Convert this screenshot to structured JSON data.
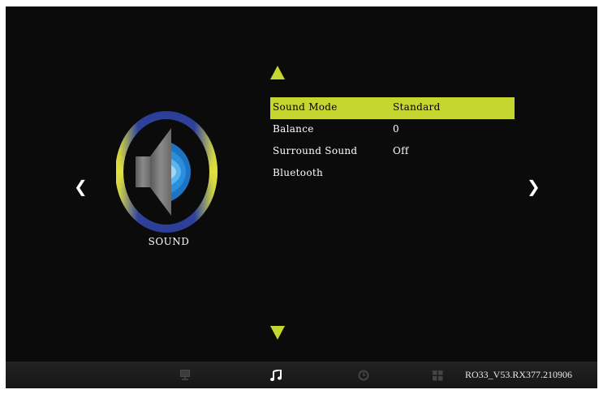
{
  "menu": {
    "items": [
      {
        "label": "Sound Mode",
        "value": "Standard",
        "selected": true
      },
      {
        "label": "Balance",
        "value": "0",
        "selected": false
      },
      {
        "label": "Surround Sound",
        "value": "Off",
        "selected": false
      },
      {
        "label": "Bluetooth",
        "value": "",
        "selected": false
      }
    ]
  },
  "section": {
    "label": "SOUND",
    "icon": "speaker-icon"
  },
  "nav": {
    "prev_glyph": "❮",
    "next_glyph": "❯",
    "tabs": [
      {
        "icon": "picture-icon",
        "active": false
      },
      {
        "icon": "music-note-icon",
        "active": true
      },
      {
        "icon": "clock-icon",
        "active": false
      },
      {
        "icon": "apps-grid-icon",
        "active": false
      }
    ]
  },
  "footer": {
    "version": "RO33_V53.RX377.210906"
  },
  "colors": {
    "accent": "#c6d631",
    "background": "#0b0b0b",
    "ring_blue": "#2b3e98",
    "ring_yellow": "#d7dc3a",
    "speaker_blue": "#1f8ad6"
  }
}
